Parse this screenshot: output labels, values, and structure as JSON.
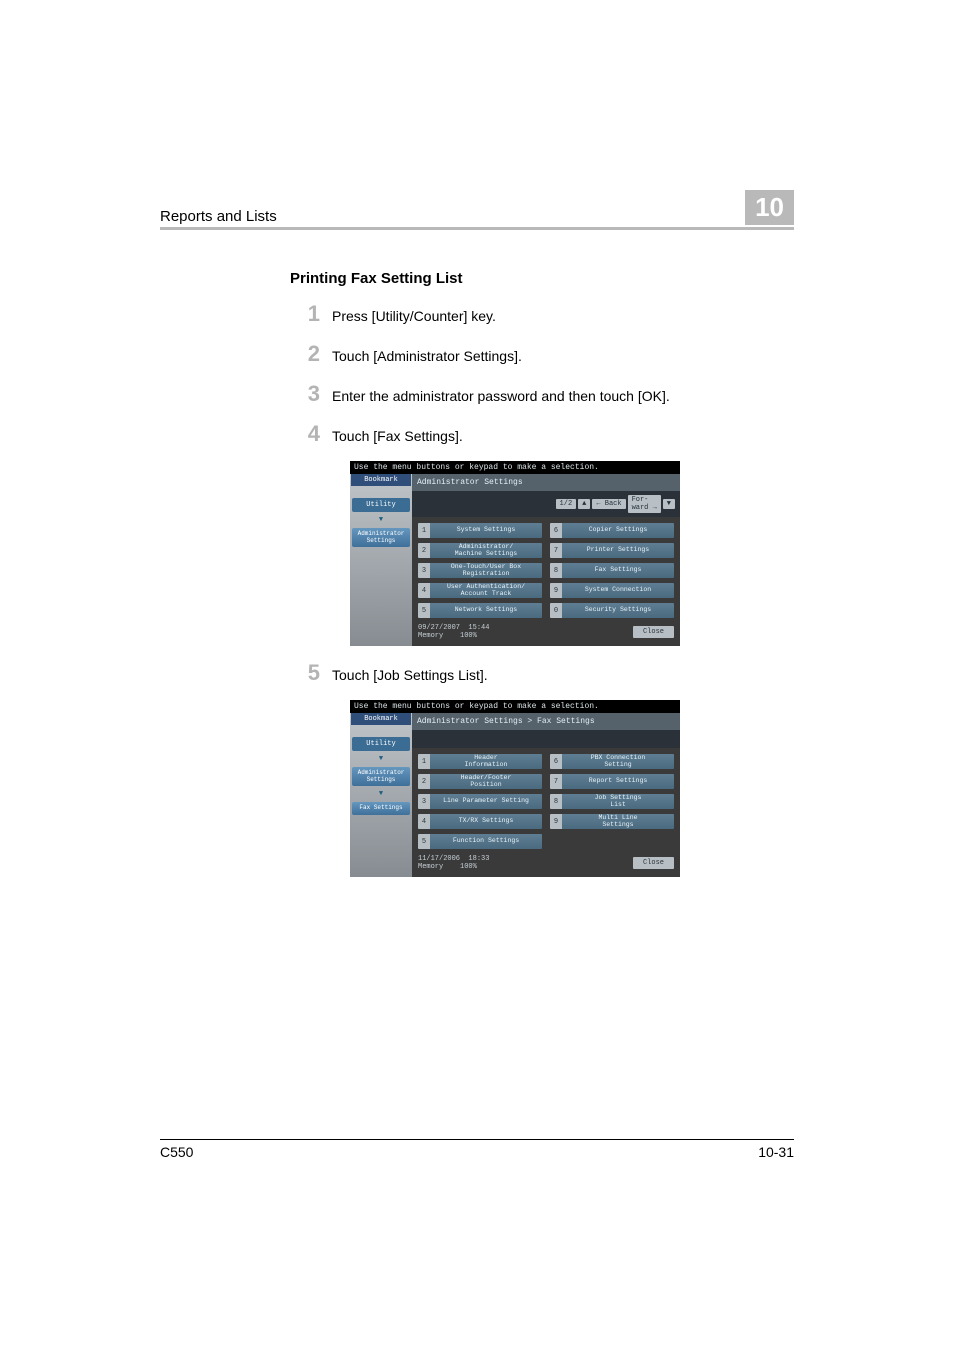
{
  "header": {
    "section": "Reports and Lists",
    "chapter": "10"
  },
  "section_title": "Printing Fax Setting List",
  "steps": [
    {
      "n": "1",
      "text": "Press [Utility/Counter] key."
    },
    {
      "n": "2",
      "text": "Touch [Administrator Settings]."
    },
    {
      "n": "3",
      "text": "Enter the administrator password and then touch [OK]."
    },
    {
      "n": "4",
      "text": "Touch [Fax Settings]."
    },
    {
      "n": "5",
      "text": "Touch [Job Settings List]."
    }
  ],
  "common_ui": {
    "top_message": "Use the menu buttons or keypad to make a selection.",
    "bookmark": "Bookmark",
    "tab_utility": "Utility",
    "tab_admin": "Administrator\nSettings",
    "tab_fax": "Fax Settings",
    "close": "Close",
    "back": "Back",
    "forward": "For-\nward"
  },
  "screen1": {
    "breadcrumb": "Administrator Settings",
    "paging": "1/2",
    "left_items": [
      {
        "n": "1",
        "label": "System Settings"
      },
      {
        "n": "2",
        "label": "Administrator/\nMachine Settings"
      },
      {
        "n": "3",
        "label": "One-Touch/User Box\nRegistration"
      },
      {
        "n": "4",
        "label": "User Authentication/\nAccount Track"
      },
      {
        "n": "5",
        "label": "Network Settings"
      }
    ],
    "right_items": [
      {
        "n": "6",
        "label": "Copier Settings"
      },
      {
        "n": "7",
        "label": "Printer Settings"
      },
      {
        "n": "8",
        "label": "Fax Settings"
      },
      {
        "n": "9",
        "label": "System Connection"
      },
      {
        "n": "0",
        "label": "Security Settings"
      }
    ],
    "footer": {
      "date": "09/27/2007",
      "time": "15:44",
      "memory_label": "Memory",
      "memory_value": "100%"
    }
  },
  "screen2": {
    "breadcrumb": "Administrator Settings  >  Fax Settings",
    "left_items": [
      {
        "n": "1",
        "label": "Header\nInformation"
      },
      {
        "n": "2",
        "label": "Header/Footer\nPosition"
      },
      {
        "n": "3",
        "label": "Line Parameter Setting"
      },
      {
        "n": "4",
        "label": "TX/RX Settings"
      },
      {
        "n": "5",
        "label": "Function Settings"
      }
    ],
    "right_items": [
      {
        "n": "6",
        "label": "PBX Connection\nSetting"
      },
      {
        "n": "7",
        "label": "Report Settings"
      },
      {
        "n": "8",
        "label": "Job Settings\nList"
      },
      {
        "n": "9",
        "label": "Multi Line\nSettings"
      }
    ],
    "footer": {
      "date": "11/17/2006",
      "time": "18:33",
      "memory_label": "Memory",
      "memory_value": "100%"
    }
  },
  "footer": {
    "left": "C550",
    "right": "10-31"
  }
}
